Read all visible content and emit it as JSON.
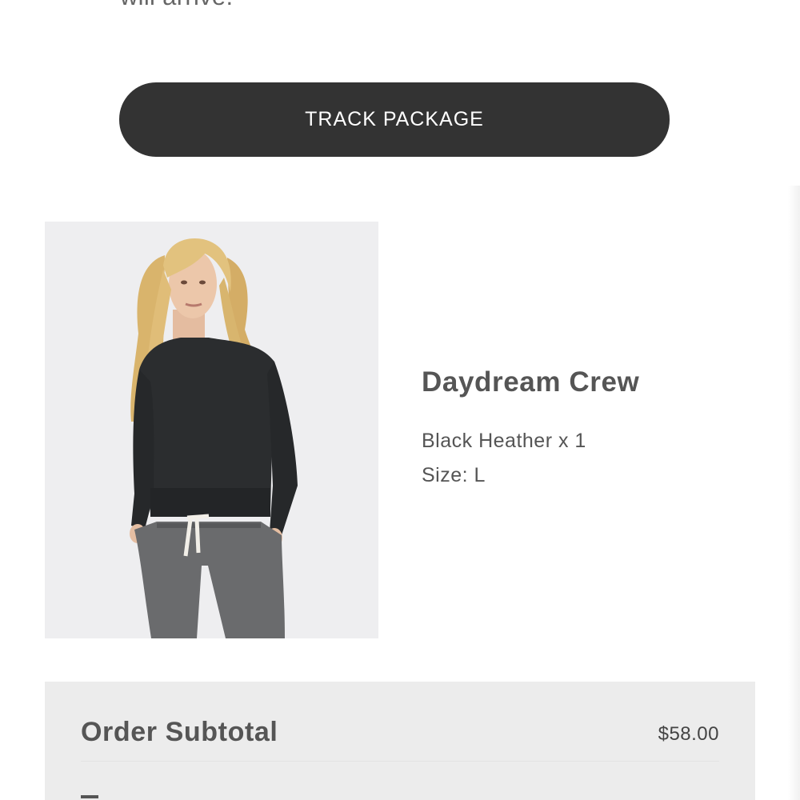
{
  "intro": {
    "text": "will arrive."
  },
  "track_button": {
    "label": "TRACK PACKAGE"
  },
  "product": {
    "image_alt": "Daydream Crew",
    "name": "Daydream Crew",
    "variant": "Black Heather x 1",
    "size": "Size: L"
  },
  "summary": {
    "subtotal_label": "Order Subtotal",
    "subtotal_value": "$58.00"
  },
  "colors": {
    "button_bg": "#333333",
    "button_text": "#ffffff",
    "summary_bg": "#ececec",
    "text_primary": "#555555",
    "image_bg": "#eeeef0"
  }
}
